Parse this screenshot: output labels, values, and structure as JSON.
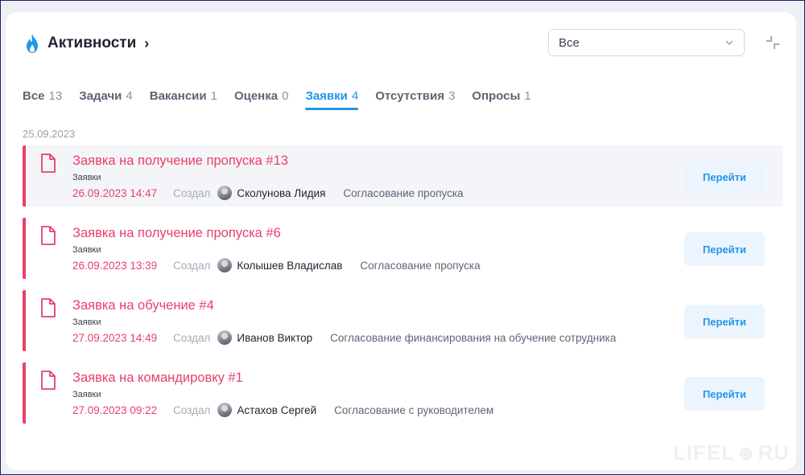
{
  "header": {
    "title": "Активности",
    "chevron": "›"
  },
  "filter": {
    "selected": "Все"
  },
  "tabs": [
    {
      "label": "Все",
      "count": "13"
    },
    {
      "label": "Задачи",
      "count": "4"
    },
    {
      "label": "Вакансии",
      "count": "1"
    },
    {
      "label": "Оценка",
      "count": "0"
    },
    {
      "label": "Заявки",
      "count": "4",
      "active": true
    },
    {
      "label": "Отсутствия",
      "count": "3"
    },
    {
      "label": "Опросы",
      "count": "1"
    }
  ],
  "date_group": "25.09.2023",
  "items": [
    {
      "name": "Заявка на получение пропуска #13",
      "type": "Заявки",
      "datetime": "26.09.2023 14:47",
      "created_by_label": "Создал",
      "person": "Сколунова Лидия",
      "process": "Согласование пропуска",
      "button": "Перейти"
    },
    {
      "name": "Заявка на получение пропуска #6",
      "type": "Заявки",
      "datetime": "26.09.2023 13:39",
      "created_by_label": "Создал",
      "person": "Колышев Владислав",
      "process": "Согласование пропуска",
      "button": "Перейти"
    },
    {
      "name": "Заявка на обучение #4",
      "type": "Заявки",
      "datetime": "27.09.2023 14:49",
      "created_by_label": "Создал",
      "person": "Иванов Виктор",
      "process": "Согласование финансирования на обучение сотрудника",
      "button": "Перейти"
    },
    {
      "name": "Заявка на командировку #1",
      "type": "Заявки",
      "datetime": "27.09.2023 09:22",
      "created_by_label": "Создал",
      "person": "Астахов Сергей",
      "process": "Согласование с руководителем",
      "button": "Перейти"
    }
  ],
  "watermark": "LIFEL☻RU",
  "colors": {
    "accent": "#2196e8",
    "request": "#e8406a"
  }
}
